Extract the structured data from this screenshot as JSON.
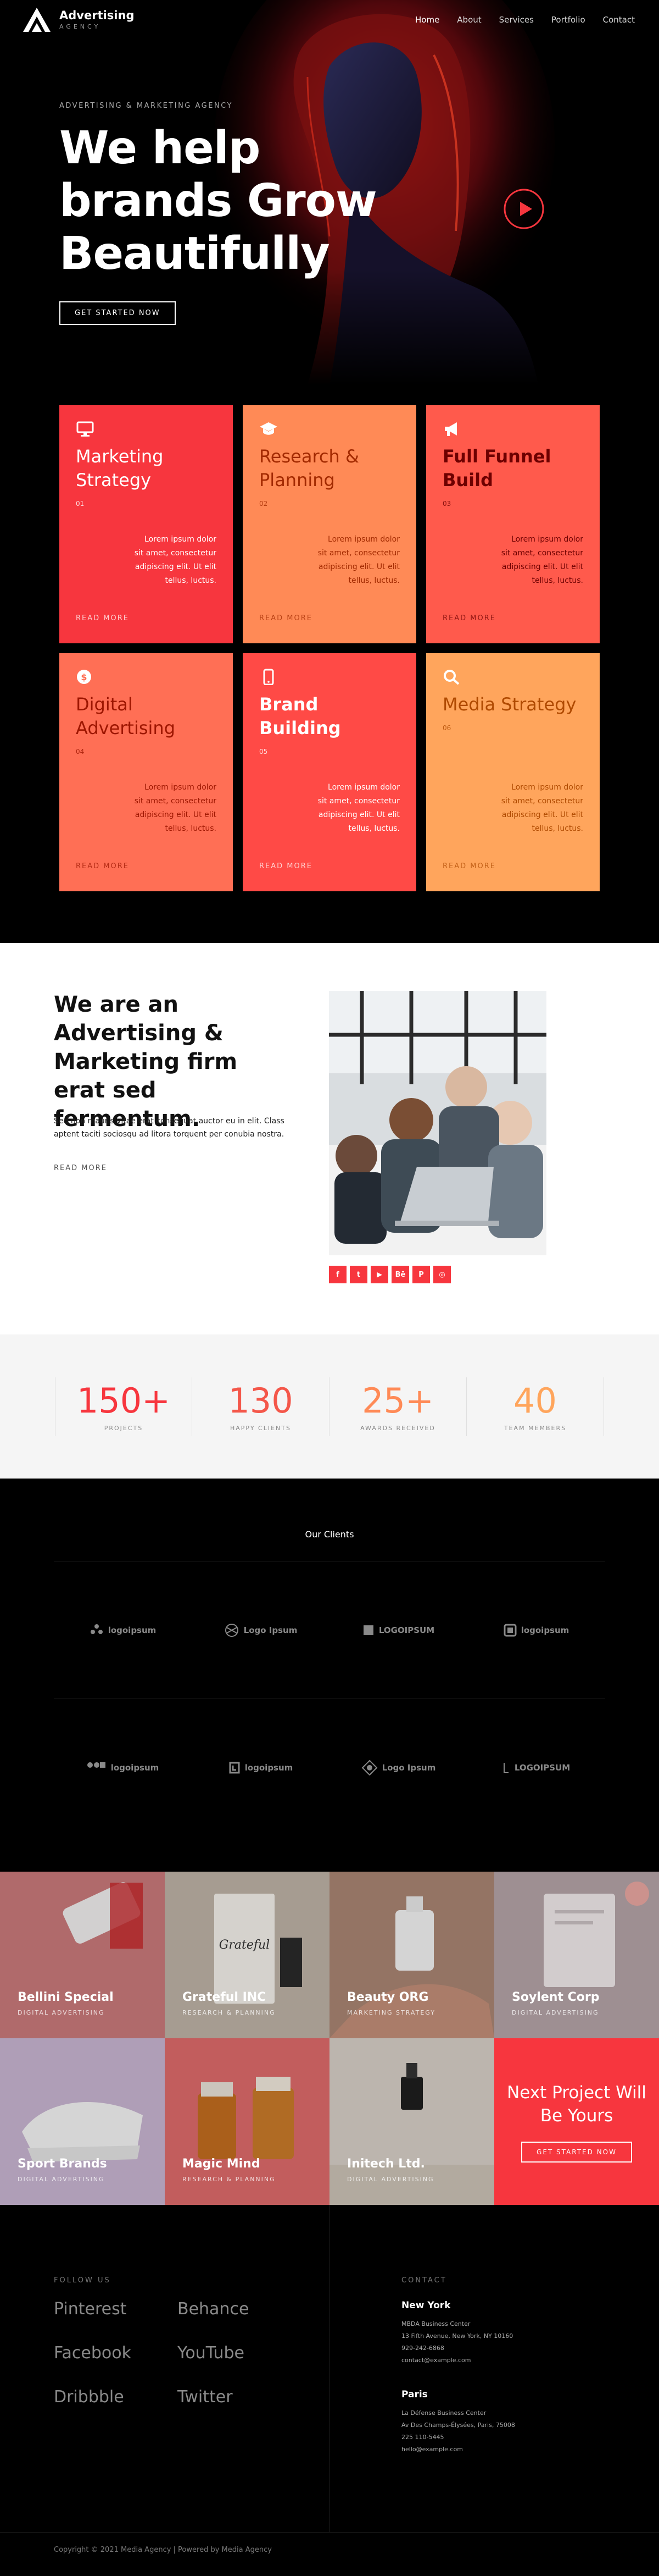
{
  "header": {
    "logo_title": "Advertising",
    "logo_sub": "AGENCY",
    "nav": [
      "Home",
      "About",
      "Services",
      "Portfolio",
      "Contact"
    ]
  },
  "hero": {
    "eyebrow": "ADVERTISING & MARKETING AGENCY",
    "title": "We help brands Grow Beautifully",
    "button": "GET STARTED NOW"
  },
  "services": [
    {
      "title": "Marketing Strategy",
      "num": "01",
      "text": "Lorem ipsum dolor sit amet, consectetur adipiscing elit. Ut elit tellus, luctus.",
      "more": "READ MORE",
      "icon": "monitor-icon",
      "bg": "#f7363e",
      "color": "#ffffff"
    },
    {
      "title": "Research & Planning",
      "num": "02",
      "text": "Lorem ipsum dolor sit amet, consectetur adipiscing elit. Ut elit tellus, luctus.",
      "more": "READ MORE",
      "icon": "graduation-cap-icon",
      "bg": "#ff8a56",
      "color": "#a32a00"
    },
    {
      "title": "Full Funnel Build",
      "num": "03",
      "text": "Lorem ipsum dolor sit amet, consectetur adipiscing elit. Ut elit tellus, luctus.",
      "more": "READ MORE",
      "icon": "megaphone-icon",
      "bg": "#ff5a4c",
      "color": "#6e0000"
    },
    {
      "title": "Digital Advertising",
      "num": "04",
      "text": "Lorem ipsum dolor sit amet, consectetur adipiscing elit. Ut elit tellus, luctus.",
      "more": "READ MORE",
      "icon": "dollar-badge-icon",
      "bg": "#ff6f55",
      "color": "#9e1600"
    },
    {
      "title": "Brand Building",
      "num": "05",
      "text": "Lorem ipsum dolor sit amet, consectetur adipiscing elit. Ut elit tellus, luctus.",
      "more": "READ MORE",
      "icon": "mobile-icon",
      "bg": "#ff4a46",
      "color": "#ffffff"
    },
    {
      "title": "Media Strategy",
      "num": "06",
      "text": "Lorem ipsum dolor sit amet, consectetur adipiscing elit. Ut elit tellus, luctus.",
      "more": "READ MORE",
      "icon": "search-icon",
      "bg": "#ffa55c",
      "color": "#b04a00"
    }
  ],
  "about": {
    "title": "We are an Advertising & Marketing firm erat sed fermentum.",
    "text": "Sed non mauris vitae erat consequat auctor eu in elit. Class aptent taciti sociosqu ad litora torquent per conubia nostra.",
    "more": "READ MORE",
    "social": [
      "facebook-icon",
      "twitter-icon",
      "youtube-icon",
      "behance-icon",
      "pinterest-icon",
      "dribbble-icon"
    ]
  },
  "stats": [
    {
      "num": "150+",
      "label": "PROJECTS",
      "color": "#f7363e"
    },
    {
      "num": "130",
      "label": "HAPPY CLIENTS",
      "color": "#f4574a"
    },
    {
      "num": "25+",
      "label": "AWARDS RECEIVED",
      "color": "#ff8a56"
    },
    {
      "num": "40",
      "label": "TEAM MEMBERS",
      "color": "#ffa55c"
    }
  ],
  "clients": {
    "title": "Our Clients",
    "logos": [
      "logoipsum",
      "Logo Ipsum",
      "LOGOIPSUM",
      "logoipsum",
      "logoipsum",
      "logoipsum",
      "Logo Ipsum",
      "LOGOIPSUM"
    ]
  },
  "portfolio": [
    {
      "title": "Bellini Special",
      "cat": "DIGITAL ADVERTISING",
      "bg": "#c9797a"
    },
    {
      "title": "Grateful INC",
      "cat": "RESEARCH & PLANNING",
      "bg": "#bdb2a6"
    },
    {
      "title": "Beauty ORG",
      "cat": "MARKETING STRATEGY",
      "bg": "#a98472"
    },
    {
      "title": "Soylent Corp",
      "cat": "DIGITAL ADVERTISING",
      "bg": "#b4a3a7"
    },
    {
      "title": "Sport Brands",
      "cat": "DIGITAL ADVERTISING",
      "bg": "#c8b4d1"
    },
    {
      "title": "Magic Mind",
      "cat": "RESEARCH & PLANNING",
      "bg": "#dd6a6a"
    },
    {
      "title": "Initech Ltd.",
      "cat": "DIGITAL ADVERTISING",
      "bg": "#d6cfc6"
    }
  ],
  "cta": {
    "title": "Next Project Will Be Yours",
    "button": "GET STARTED NOW"
  },
  "footer": {
    "follow_label": "FOLLOW US",
    "links": [
      "Pinterest",
      "Behance",
      "Facebook",
      "YouTube",
      "Dribbble",
      "Twitter"
    ],
    "contact_label": "CONTACT",
    "offices": [
      {
        "city": "New York",
        "lines": [
          "MBDA Business Center",
          "13 Fifth Avenue, New York, NY 10160",
          "929-242-6868",
          "contact@example.com"
        ]
      },
      {
        "city": "Paris",
        "lines": [
          "La Défense Business Center",
          "Av Des Champs-Élysées, Paris, 75008",
          "225 110-5445",
          "hello@example.com"
        ]
      }
    ],
    "copyright": "Copyright © 2021 Media Agency | Powered by Media Agency"
  }
}
